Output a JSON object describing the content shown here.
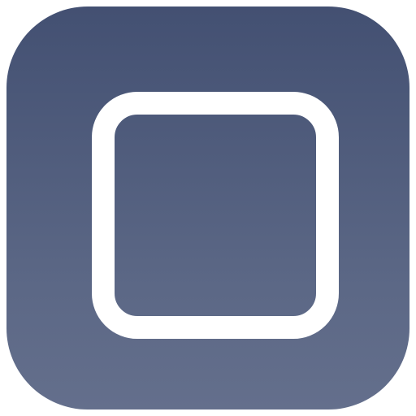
{
  "app_icon": {
    "icon_name": "rounded-square-outline-icon",
    "gradient_top_color": "#435072",
    "gradient_bottom_color": "#646f8c",
    "glyph_color": "#ffffff"
  }
}
